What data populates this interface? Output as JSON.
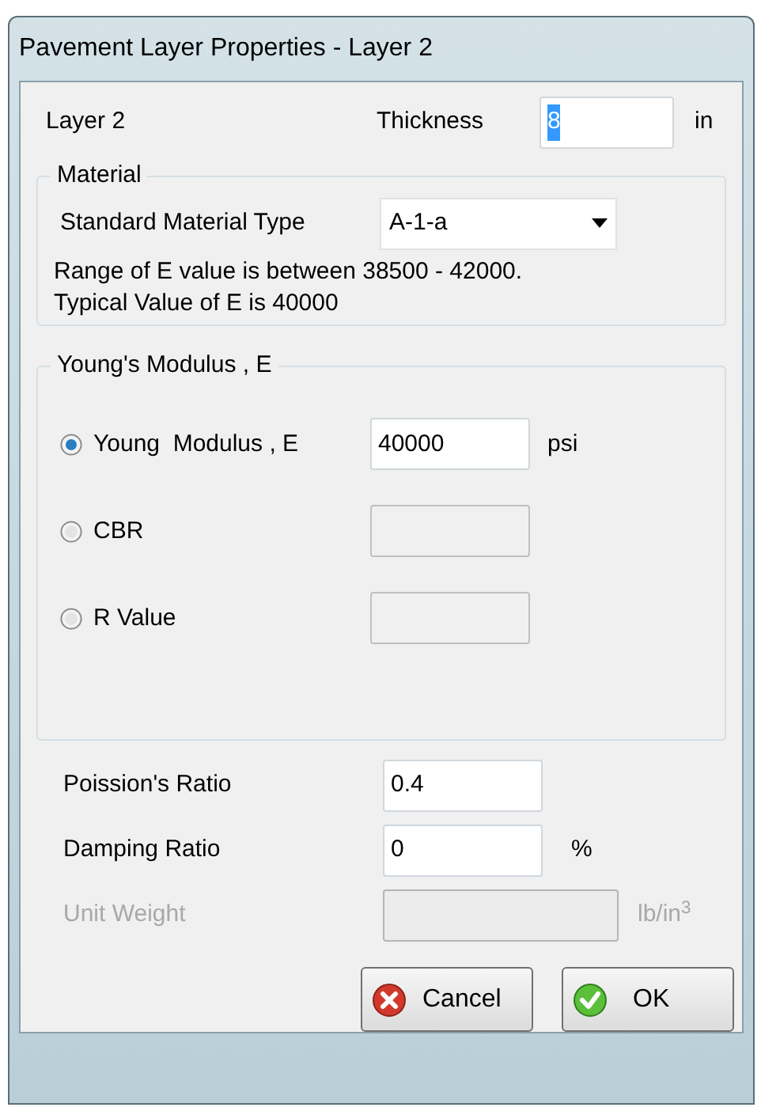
{
  "window": {
    "title": "Pavement Layer Properties - Layer 2"
  },
  "layer": {
    "label": "Layer 2",
    "thickness_label": "Thickness",
    "thickness": {
      "value": "8",
      "highlighted": true
    },
    "unit": "in"
  },
  "material": {
    "group_label": "Material",
    "type_label": "Standard Material Type",
    "type_value": "A-1-a",
    "range_text": "Range of E value is between 38500 - 42000.",
    "typical_text": "Typical Value of E is 40000"
  },
  "modulus": {
    "group_label": "Young's Modulus , E",
    "options": [
      {
        "label": "Young  Modulus , E",
        "selected": true,
        "value": "40000",
        "unit": "psi"
      },
      {
        "label": "CBR",
        "selected": false
      },
      {
        "label": "R Value",
        "selected": false
      }
    ]
  },
  "properties": [
    {
      "label": "Poission's Ratio",
      "value": "0.4",
      "disabled": false
    },
    {
      "label": "Damping Ratio",
      "value": "0",
      "unit": "%",
      "disabled": false
    },
    {
      "label": "Unit Weight",
      "unit": "lb/in$^{3}$",
      "disabled": true
    }
  ],
  "buttons": [
    {
      "kind": "cancel",
      "label": "Cancel"
    },
    {
      "kind": "ok",
      "label": "OK"
    }
  ]
}
